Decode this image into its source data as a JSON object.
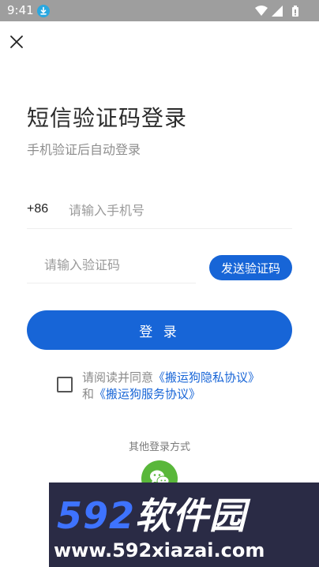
{
  "status_bar": {
    "time": "9:41",
    "icons": [
      "download-icon",
      "wifi-icon",
      "signal-icon",
      "battery-icon"
    ]
  },
  "nav": {
    "close_icon": "close-icon"
  },
  "header": {
    "title": "短信验证码登录",
    "subtitle": "手机验证后自动登录"
  },
  "form": {
    "country_code": "+86",
    "phone_placeholder": "请输入手机号",
    "phone_value": "",
    "code_placeholder": "请输入验证码",
    "code_value": "",
    "send_code_label": "发送验证码",
    "login_label": "登 录"
  },
  "agreement": {
    "checked": false,
    "prefix": "请阅读并同意",
    "privacy_link": "《搬运狗隐私协议》",
    "and_text": "和",
    "service_link": "《搬运狗服务协议》"
  },
  "other_login": {
    "label": "其他登录方式",
    "wechat_icon": "wechat-icon"
  },
  "watermark": {
    "brand_number": "592",
    "brand_text": "软件园",
    "url": "www.592xiazai.com"
  },
  "colors": {
    "accent": "#1765d7",
    "status_bar": "#9e9e9e",
    "wechat": "#59b73a",
    "watermark_bg": "#2a2b45"
  }
}
